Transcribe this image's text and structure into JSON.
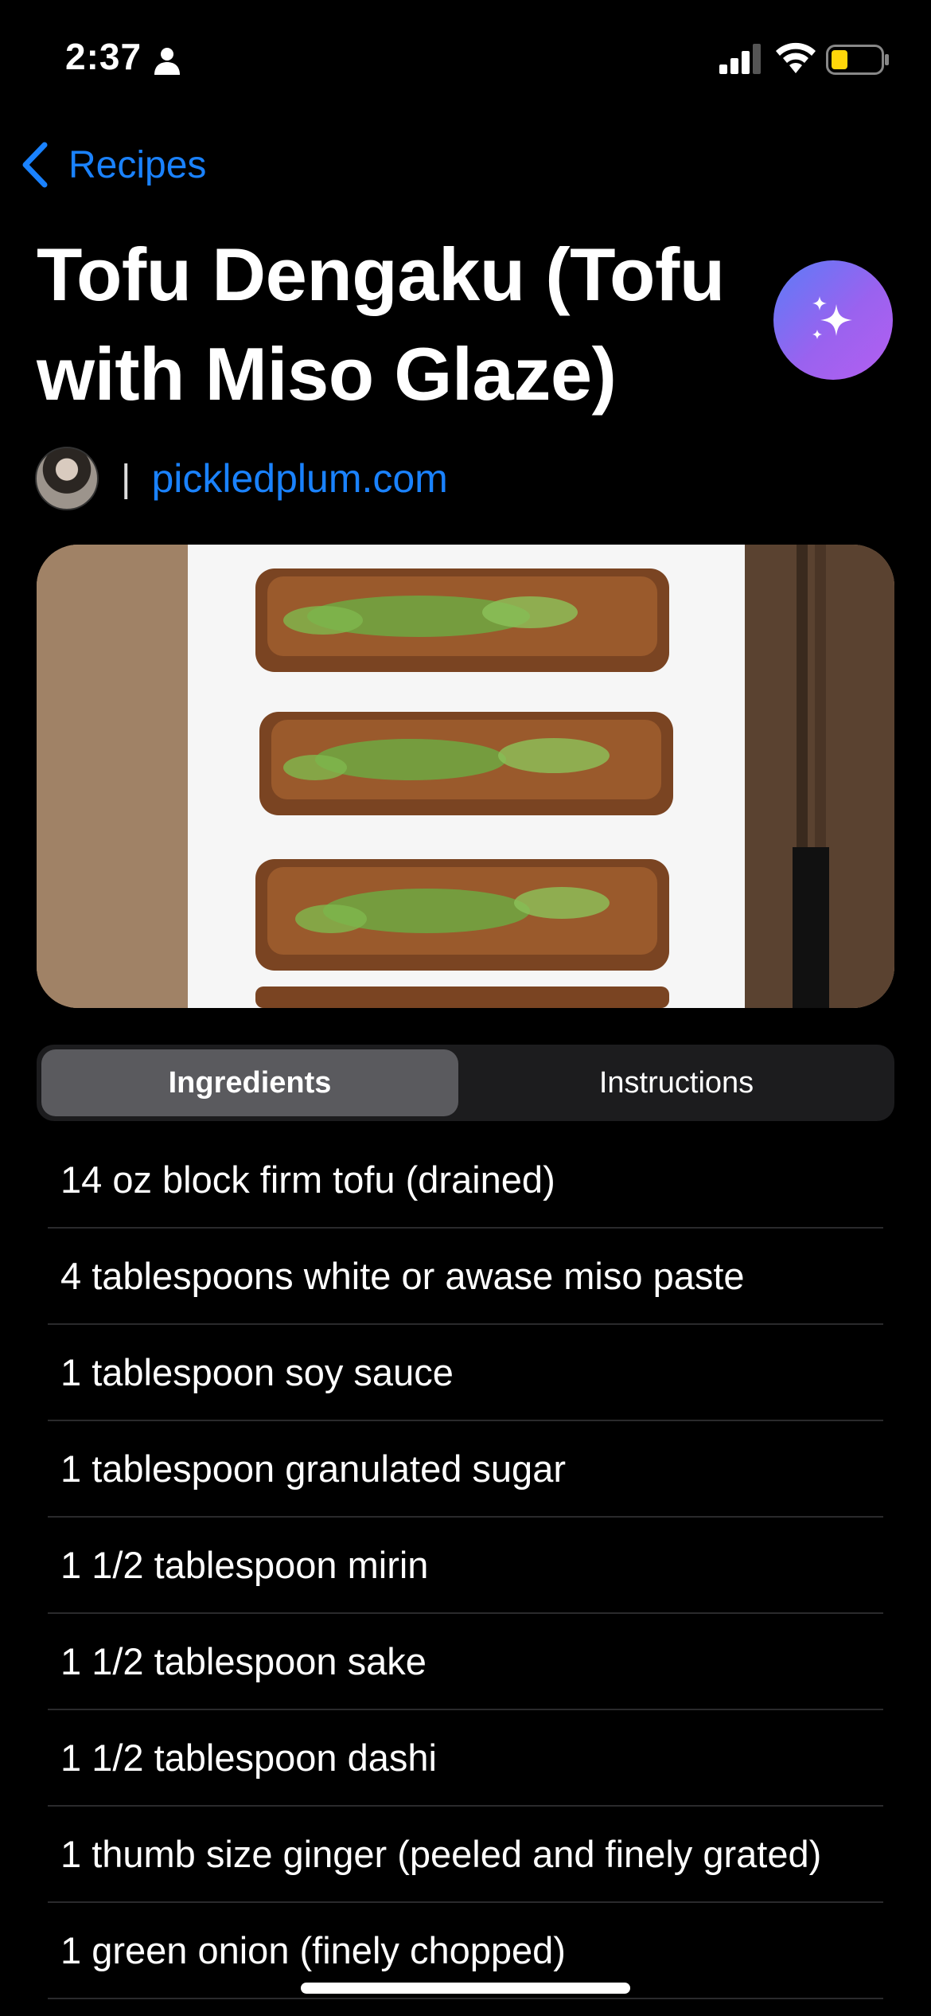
{
  "status_bar": {
    "time": "2:37",
    "battery_color": "#ffd60a"
  },
  "nav": {
    "back_label": "Recipes"
  },
  "recipe": {
    "title": "Tofu Dengaku (Tofu with Miso Glaze)",
    "source": "pickledplum.com",
    "separator": "|"
  },
  "tabs": [
    {
      "label": "Ingredients",
      "selected": true
    },
    {
      "label": "Instructions",
      "selected": false
    }
  ],
  "ingredients": [
    "14 oz block firm tofu (drained)",
    "4 tablespoons white or awase miso paste",
    "1 tablespoon soy sauce",
    "1 tablespoon granulated sugar",
    "1 1/2 tablespoon mirin",
    "1 1/2 tablespoon sake",
    "1 1/2 tablespoon dashi",
    "1 thumb size ginger (peeled and finely grated)",
    "1 green onion (finely chopped)"
  ],
  "colors": {
    "accent": "#1a82ff",
    "background": "#000000"
  }
}
